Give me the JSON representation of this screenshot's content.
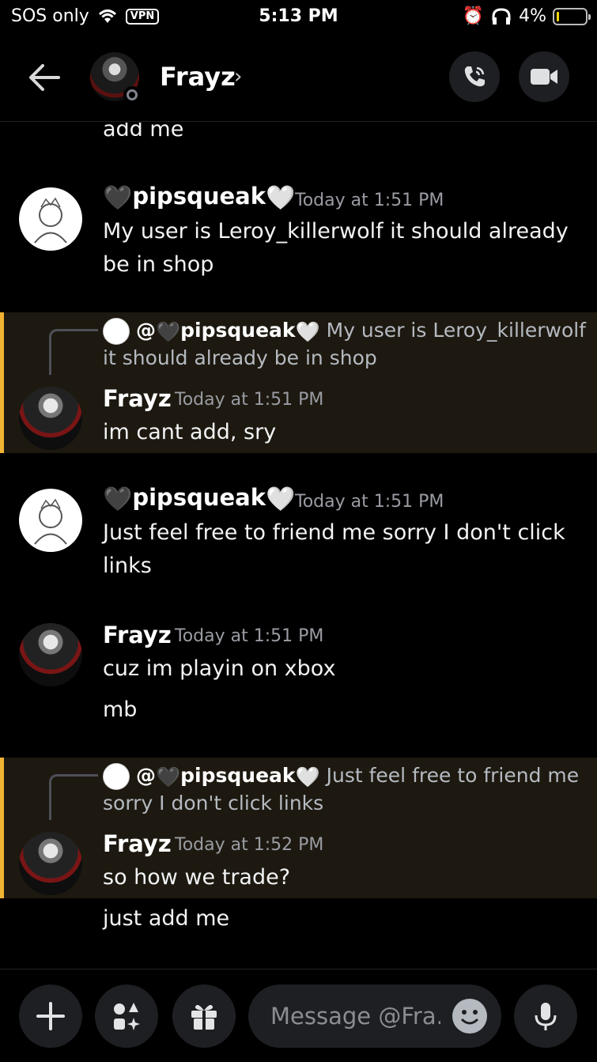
{
  "status_bar": {
    "carrier": "SOS only",
    "vpn": "VPN",
    "time": "5:13 PM",
    "battery": "4%"
  },
  "header": {
    "name": "Frayz",
    "chevron": "›"
  },
  "messages": {
    "partial_top": "add me",
    "m1": {
      "author": "pipsqueak",
      "timestamp": "Today at 1:51 PM",
      "lines": [
        "My user is Leroy_killerwolf it should already",
        "be in shop"
      ]
    },
    "m2": {
      "reply_mention": "@",
      "reply_author": "pipsqueak",
      "reply_text_1": "My user is Leroy_killerwolf",
      "reply_text_2": "it should already be in shop",
      "author": "Frayz",
      "timestamp": "Today at 1:51 PM",
      "text": "im cant add, sry"
    },
    "m3": {
      "author": "pipsqueak",
      "timestamp": "Today at 1:51 PM",
      "lines": [
        "Just feel free to friend me sorry I don't click",
        "links"
      ]
    },
    "m4": {
      "author": "Frayz",
      "timestamp": "Today at 1:51 PM",
      "lines": [
        "cuz im playin on xbox",
        "mb"
      ]
    },
    "m5": {
      "reply_mention": "@",
      "reply_author": "pipsqueak",
      "reply_text_1": "Just feel free to friend me",
      "reply_text_2": "sorry I don't click links",
      "author": "Frayz",
      "timestamp": "Today at 1:52 PM",
      "text": "so how we trade?"
    },
    "m6": {
      "text": "just add me"
    }
  },
  "composer": {
    "placeholder": "Message @Fra.."
  },
  "colors": {
    "background": "#000000",
    "highlight_bar": "#f0b232",
    "highlight_bg": "#1d1910",
    "timestamp": "#9a9ca3"
  }
}
